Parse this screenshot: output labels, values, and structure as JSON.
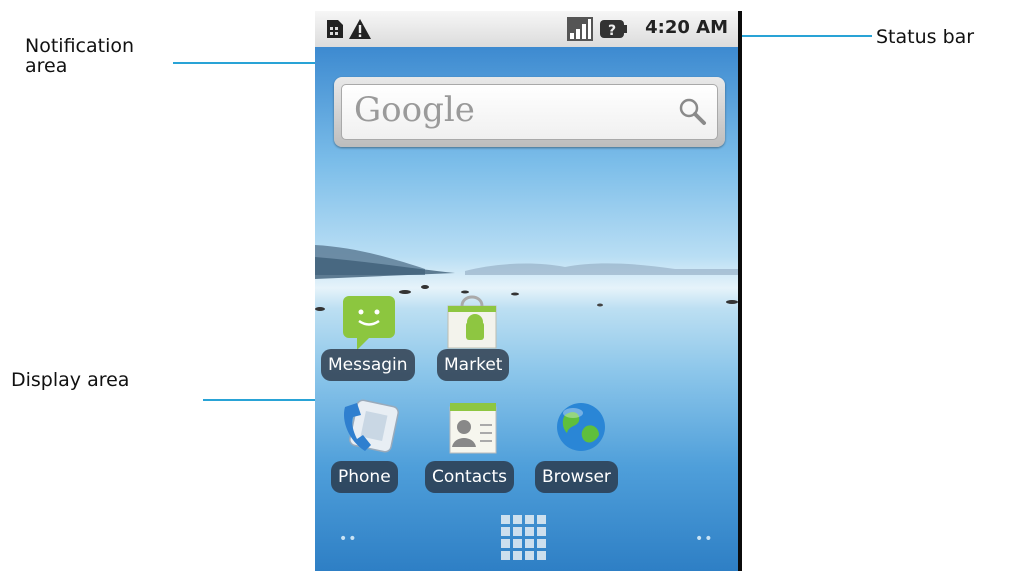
{
  "callouts": {
    "notification_area": [
      "Notification",
      "area"
    ],
    "status_bar": "Status bar",
    "display_area": "Display area"
  },
  "status_bar": {
    "time": "4:20 AM",
    "icons": [
      "sim-card-icon",
      "warning-icon",
      "signal-strength-icon",
      "battery-unknown-icon"
    ]
  },
  "search_widget": {
    "placeholder": "Google",
    "icon": "magnifier-icon"
  },
  "apps": [
    {
      "label": "Messagin",
      "icon": "messaging-icon"
    },
    {
      "label": "Market",
      "icon": "market-icon"
    },
    {
      "label": "Phone",
      "icon": "phone-icon"
    },
    {
      "label": "Contacts",
      "icon": "contacts-icon"
    },
    {
      "label": "Browser",
      "icon": "browser-icon"
    }
  ],
  "dock": {
    "launcher_icon": "app-drawer-icon",
    "left_indicator": "••",
    "right_indicator": "••"
  },
  "colors": {
    "callout_line": "#29a3d6",
    "label_bg": "#283241"
  }
}
